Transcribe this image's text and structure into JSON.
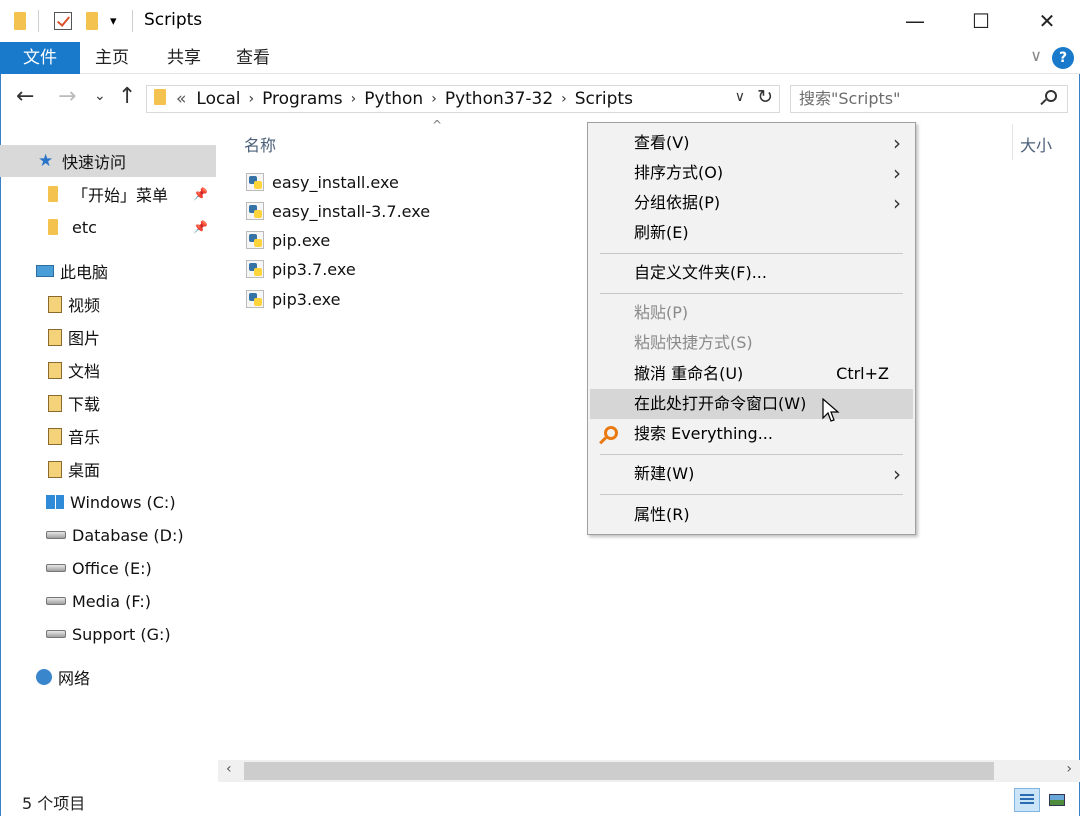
{
  "window": {
    "title": "Scripts",
    "minimize": "—",
    "maximize": "☐",
    "close": "✕"
  },
  "ribbon": {
    "tabs": [
      "文件",
      "主页",
      "共享",
      "查看"
    ],
    "help": "?"
  },
  "nav": {
    "back": "←",
    "forward": "→",
    "recent": "⌄",
    "up": "↑",
    "breadcrumb_prefix": "«",
    "breadcrumb": [
      "Local",
      "Programs",
      "Python",
      "Python37-32",
      "Scripts"
    ],
    "search_placeholder": "搜索\"Scripts\""
  },
  "sidebar": {
    "quick_access": "快速访问",
    "quick_items": [
      "「开始」菜单",
      "etc"
    ],
    "this_pc": "此电脑",
    "pc_items": [
      "视频",
      "图片",
      "文档",
      "下载",
      "音乐",
      "桌面"
    ],
    "drives": [
      "Windows (C:)",
      "Database (D:)",
      "Office (E:)",
      "Media (F:)",
      "Support (G:)"
    ],
    "network": "网络"
  },
  "content": {
    "col_name": "名称",
    "col_size": "大小",
    "files": [
      "easy_install.exe",
      "easy_install-3.7.exe",
      "pip.exe",
      "pip3.7.exe",
      "pip3.exe"
    ]
  },
  "context_menu": {
    "items": [
      {
        "label": "查看(V)",
        "submenu": true
      },
      {
        "label": "排序方式(O)",
        "submenu": true
      },
      {
        "label": "分组依据(P)",
        "submenu": true
      },
      {
        "label": "刷新(E)"
      },
      {
        "label": "自定义文件夹(F)..."
      },
      {
        "label": "粘贴(P)",
        "disabled": true
      },
      {
        "label": "粘贴快捷方式(S)",
        "disabled": true
      },
      {
        "label": "撤消 重命名(U)",
        "shortcut": "Ctrl+Z"
      },
      {
        "label": "在此处打开命令窗口(W)",
        "hover": true
      },
      {
        "label": "搜索 Everything..."
      },
      {
        "label": "新建(W)",
        "submenu": true
      },
      {
        "label": "属性(R)"
      }
    ],
    "submenu_arrow": "〉"
  },
  "status": {
    "item_count": "5 个项目"
  },
  "colors": {
    "accent": "#1979ca",
    "menu_bg": "#f2f2f2",
    "selected_nav": "#d9d9d9"
  }
}
